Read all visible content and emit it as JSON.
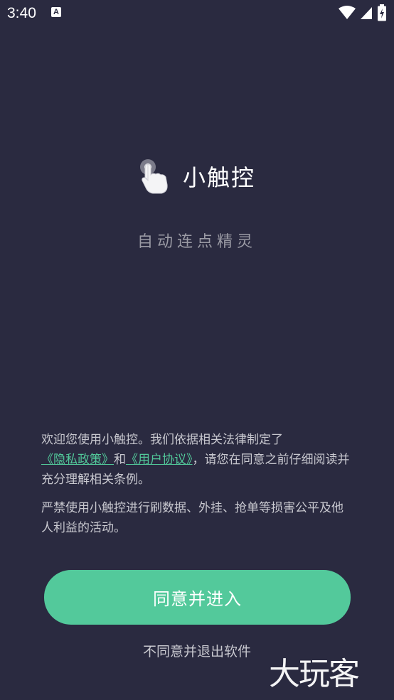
{
  "status_bar": {
    "time": "3:40",
    "notification_icon": "a-letter-icon",
    "icons": [
      "wifi-icon",
      "cell-signal-icon",
      "battery-charging-icon"
    ]
  },
  "app": {
    "name": "小触控",
    "slogan": "自动连点精灵",
    "logo_icon": "tapping-hand-icon"
  },
  "agreement": {
    "intro_prefix": "欢迎您使用小触控。我们依据相关法律制定了",
    "privacy_link": "《隐私政策》",
    "conjunction": "和",
    "user_agreement_link": "《用户协议》",
    "intro_suffix": "，请您在同意之前仔细阅读并充分理解相关条例。",
    "warning": "严禁使用小触控进行刷数据、外挂、抢单等损害公平及他人利益的活动。"
  },
  "buttons": {
    "agree_label": "同意并进入",
    "decline_label": "不同意并退出软件"
  },
  "watermark": "大玩客",
  "colors": {
    "background": "#2a2a40",
    "accent": "#53c99b",
    "link": "#52c99a",
    "text": "#c8c8cf"
  }
}
